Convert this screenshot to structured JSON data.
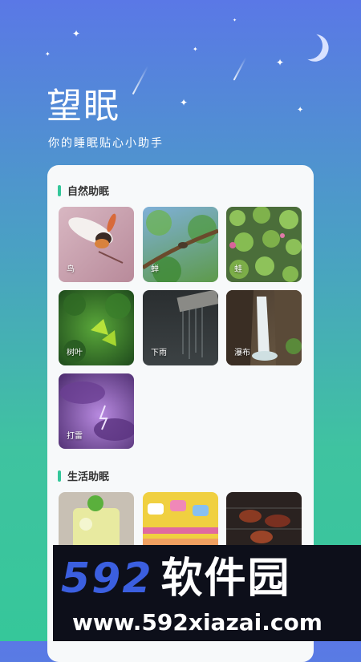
{
  "header": {
    "title": "望眠",
    "subtitle": "你的睡眠贴心小助手"
  },
  "sections": {
    "nature": {
      "label": "自然助眠",
      "items": [
        {
          "label": "鸟",
          "icon": "bird-image"
        },
        {
          "label": "蝉",
          "icon": "cicada-image"
        },
        {
          "label": "蛙",
          "icon": "frog-image"
        },
        {
          "label": "树叶",
          "icon": "leaves-image"
        },
        {
          "label": "下雨",
          "icon": "rain-image"
        },
        {
          "label": "瀑布",
          "icon": "waterfall-image"
        },
        {
          "label": "打雷",
          "icon": "thunder-image"
        }
      ]
    },
    "life": {
      "label": "生活助眠",
      "items": [
        {
          "label": "",
          "icon": "drink-image"
        },
        {
          "label": "",
          "icon": "candy-image"
        },
        {
          "label": "",
          "icon": "bbq-image"
        }
      ]
    }
  },
  "watermark": {
    "line1_num": "592",
    "line1_cn": "软件园",
    "line2": "www.592xiazai.com"
  },
  "colors": {
    "accent": "#34c79a",
    "bg_top": "#5a78e6",
    "bg_bottom": "#36c79a"
  }
}
